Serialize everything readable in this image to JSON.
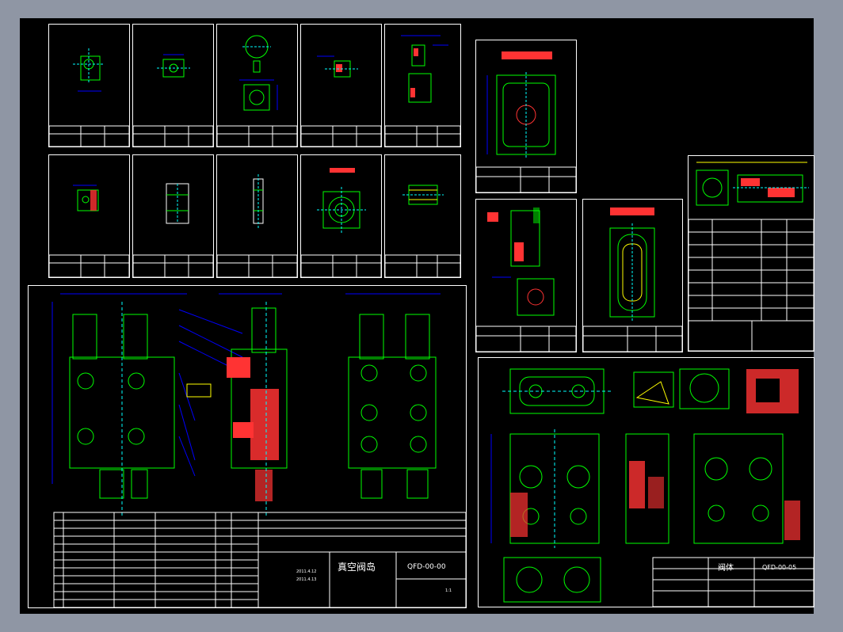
{
  "drawing": {
    "assembly_title": "真空阀岛",
    "assembly_code": "QFD-00-00",
    "body_title": "阀体",
    "body_code": "QFD-00-05",
    "date_1": "2011.4.12",
    "date_2": "2011.4.13",
    "scale": "1:1"
  },
  "colors": {
    "background": "#000000",
    "frame": "#ffffff",
    "outline": "#00ff00",
    "dimension": "#0000ff",
    "section": "#ff3333",
    "centerline": "#00ffff",
    "annotation": "#ffff00"
  }
}
